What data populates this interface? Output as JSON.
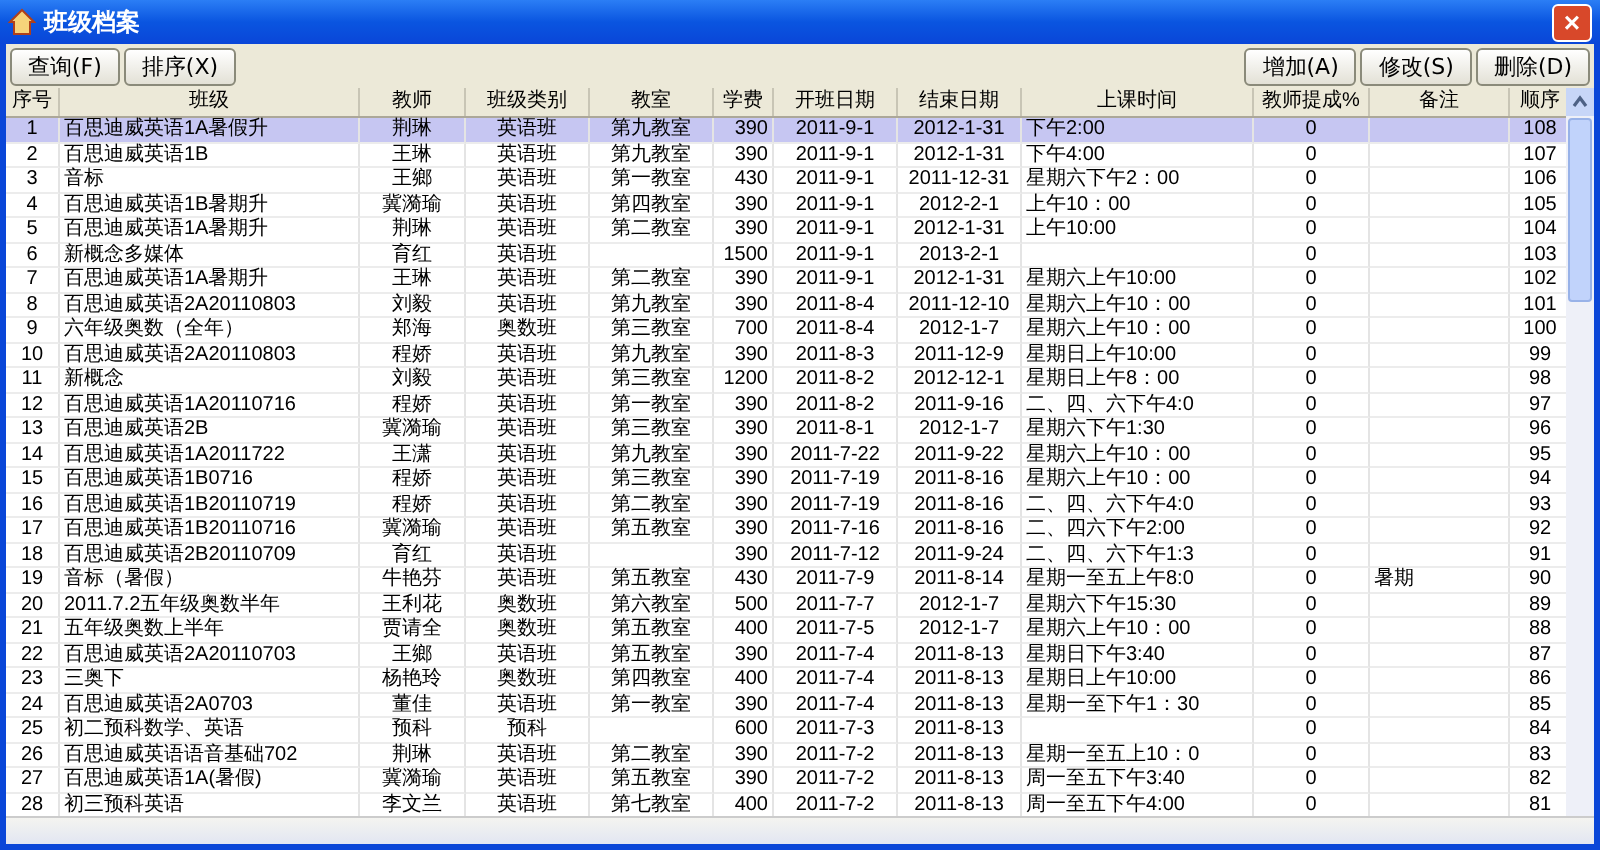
{
  "window": {
    "title": "班级档案",
    "close": "×"
  },
  "toolbar": {
    "left": [
      "查询(F)",
      "排序(X)"
    ],
    "right": [
      "增加(A)",
      "修改(S)",
      "删除(D)"
    ]
  },
  "table": {
    "columns": [
      "序号",
      "班级",
      "教师",
      "班级类别",
      "教室",
      "学费",
      "开班日期",
      "结束日期",
      "上课时间",
      "教师提成%",
      "备注",
      "顺序"
    ],
    "rows": [
      {
        "selected": true,
        "no": "1",
        "class": "百思迪威英语1A暑假升",
        "teacher": "荆琳",
        "category": "英语班",
        "room": "第九教室",
        "fee": "390",
        "start": "2011-9-1",
        "end": "2012-1-31",
        "time": "下午2:00",
        "commission": "0",
        "order": "108"
      },
      {
        "selected": false,
        "no": "2",
        "class": "百思迪威英语1B",
        "teacher": "王琳",
        "category": "英语班",
        "room": "第九教室",
        "fee": "390",
        "start": "2011-9-1",
        "end": "2012-1-31",
        "time": "下午4:00",
        "commission": "0",
        "order": "107"
      },
      {
        "selected": false,
        "no": "3",
        "class": "音标",
        "teacher": "王鄉",
        "category": "英语班",
        "room": "第一教室",
        "fee": "430",
        "start": "2011-9-1",
        "end": "2011-12-31",
        "time": "星期六下午2：00",
        "commission": "0",
        "order": "106"
      },
      {
        "selected": false,
        "no": "4",
        "class": "百思迪威英语1B暑期升",
        "teacher": "冀漪瑜",
        "category": "英语班",
        "room": "第四教室",
        "fee": "390",
        "start": "2011-9-1",
        "end": "2012-2-1",
        "time": "上午10：00",
        "commission": "0",
        "order": "105"
      },
      {
        "selected": false,
        "no": "5",
        "class": "百思迪威英语1A暑期升",
        "teacher": "荆琳",
        "category": "英语班",
        "room": "第二教室",
        "fee": "390",
        "start": "2011-9-1",
        "end": "2012-1-31",
        "time": "上午10:00",
        "commission": "0",
        "order": "104"
      },
      {
        "selected": false,
        "no": "6",
        "class": "新概念多媒体",
        "teacher": "育红",
        "category": "英语班",
        "fee": "1500",
        "start": "2011-9-1",
        "end": "2013-2-1",
        "commission": "0",
        "order": "103"
      },
      {
        "selected": false,
        "no": "7",
        "class": "百思迪威英语1A暑期升",
        "teacher": "王琳",
        "category": "英语班",
        "room": "第二教室",
        "fee": "390",
        "start": "2011-9-1",
        "end": "2012-1-31",
        "time": "星期六上午10:00",
        "commission": "0",
        "order": "102"
      },
      {
        "selected": false,
        "no": "8",
        "class": "百思迪威英语2A20110803",
        "teacher": "刘毅",
        "category": "英语班",
        "room": "第九教室",
        "fee": "390",
        "start": "2011-8-4",
        "end": "2011-12-10",
        "time": "星期六上午10：00",
        "commission": "0",
        "order": "101"
      },
      {
        "selected": false,
        "no": "9",
        "class": "六年级奥数（全年）",
        "teacher": "郑海",
        "category": "奥数班",
        "room": "第三教室",
        "fee": "700",
        "start": "2011-8-4",
        "end": "2012-1-7",
        "time": "星期六上午10：00",
        "commission": "0",
        "order": "100"
      },
      {
        "selected": false,
        "no": "10",
        "class": "百思迪威英语2A20110803",
        "teacher": "程娇",
        "category": "英语班",
        "room": "第九教室",
        "fee": "390",
        "start": "2011-8-3",
        "end": "2011-12-9",
        "time": "星期日上午10:00",
        "commission": "0",
        "order": "99"
      },
      {
        "selected": false,
        "no": "11",
        "class": "新概念",
        "teacher": "刘毅",
        "category": "英语班",
        "room": "第三教室",
        "fee": "1200",
        "start": "2011-8-2",
        "end": "2012-12-1",
        "time": "星期日上午8：00",
        "commission": "0",
        "order": "98"
      },
      {
        "selected": false,
        "no": "12",
        "class": "百思迪威英语1A20110716",
        "teacher": "程娇",
        "category": "英语班",
        "room": "第一教室",
        "fee": "390",
        "start": "2011-8-2",
        "end": "2011-9-16",
        "time": "二、四、六下午4:0",
        "commission": "0",
        "order": "97"
      },
      {
        "selected": false,
        "no": "13",
        "class": "百思迪威英语2B",
        "teacher": "冀漪瑜",
        "category": "英语班",
        "room": "第三教室",
        "fee": "390",
        "start": "2011-8-1",
        "end": "2012-1-7",
        "time": "星期六下午1:30",
        "commission": "0",
        "order": "96"
      },
      {
        "selected": false,
        "no": "14",
        "class": "百思迪威英语1A2011722",
        "teacher": "王潇",
        "category": "英语班",
        "room": "第九教室",
        "fee": "390",
        "start": "2011-7-22",
        "end": "2011-9-22",
        "time": "星期六上午10：00",
        "commission": "0",
        "order": "95"
      },
      {
        "selected": false,
        "no": "15",
        "class": "百思迪威英语1B0716",
        "teacher": "程娇",
        "category": "英语班",
        "room": "第三教室",
        "fee": "390",
        "start": "2011-7-19",
        "end": "2011-8-16",
        "time": "星期六上午10：00",
        "commission": "0",
        "order": "94"
      },
      {
        "selected": false,
        "no": "16",
        "class": "百思迪威英语1B20110719",
        "teacher": "程娇",
        "category": "英语班",
        "room": "第二教室",
        "fee": "390",
        "start": "2011-7-19",
        "end": "2011-8-16",
        "time": "二、四、六下午4:0",
        "commission": "0",
        "order": "93"
      },
      {
        "selected": false,
        "no": "17",
        "class": "百思迪威英语1B20110716",
        "teacher": "冀漪瑜",
        "category": "英语班",
        "room": "第五教室",
        "fee": "390",
        "start": "2011-7-16",
        "end": "2011-8-16",
        "time": "二、四六下午2:00",
        "commission": "0",
        "order": "92"
      },
      {
        "selected": false,
        "no": "18",
        "class": "百思迪威英语2B20110709",
        "teacher": "育红",
        "category": "英语班",
        "fee": "390",
        "start": "2011-7-12",
        "end": "2011-9-24",
        "time": "二、四、六下午1:3",
        "commission": "0",
        "order": "91"
      },
      {
        "selected": false,
        "no": "19",
        "class": "音标（暑假）",
        "teacher": "牛艳芬",
        "category": "英语班",
        "room": "第五教室",
        "fee": "430",
        "start": "2011-7-9",
        "end": "2011-8-14",
        "time": "星期一至五上午8:0",
        "commission": "0",
        "note": "暑期",
        "order": "90"
      },
      {
        "selected": false,
        "no": "20",
        "class": "2011.7.2五年级奥数半年",
        "teacher": "王利花",
        "category": "奥数班",
        "room": "第六教室",
        "fee": "500",
        "start": "2011-7-7",
        "end": "2012-1-7",
        "time": "星期六下午15:30",
        "commission": "0",
        "order": "89"
      },
      {
        "selected": false,
        "no": "21",
        "class": "五年级奥数上半年",
        "teacher": "贾请全",
        "category": "奥数班",
        "room": "第五教室",
        "fee": "400",
        "start": "2011-7-5",
        "end": "2012-1-7",
        "time": "星期六上午10：00",
        "commission": "0",
        "order": "88"
      },
      {
        "selected": false,
        "no": "22",
        "class": "百思迪威英语2A20110703",
        "teacher": "王鄉",
        "category": "英语班",
        "room": "第五教室",
        "fee": "390",
        "start": "2011-7-4",
        "end": "2011-8-13",
        "time": "星期日下午3:40",
        "commission": "0",
        "order": "87"
      },
      {
        "selected": false,
        "no": "23",
        "class": "三奥下",
        "teacher": "杨艳玲",
        "category": "奥数班",
        "room": "第四教室",
        "fee": "400",
        "start": "2011-7-4",
        "end": "2011-8-13",
        "time": "星期日上午10:00",
        "commission": "0",
        "order": "86"
      },
      {
        "selected": false,
        "no": "24",
        "class": "百思迪威英语2A0703",
        "teacher": "董佳",
        "category": "英语班",
        "room": "第一教室",
        "fee": "390",
        "start": "2011-7-4",
        "end": "2011-8-13",
        "time": "星期一至下午1：30",
        "commission": "0",
        "order": "85"
      },
      {
        "selected": false,
        "no": "25",
        "class": "初二预科数学、英语",
        "teacher": "预科",
        "category": "预科",
        "fee": "600",
        "start": "2011-7-3",
        "end": "2011-8-13",
        "commission": "0",
        "order": "84"
      },
      {
        "selected": false,
        "no": "26",
        "class": "百思迪威英语语音基础702",
        "teacher": "荆琳",
        "category": "英语班",
        "room": "第二教室",
        "fee": "390",
        "start": "2011-7-2",
        "end": "2011-8-13",
        "time": "星期一至五上10：0",
        "commission": "0",
        "order": "83"
      },
      {
        "selected": false,
        "no": "27",
        "class": "百思迪威英语1A(暑假)",
        "teacher": "冀漪瑜",
        "category": "英语班",
        "room": "第五教室",
        "fee": "390",
        "start": "2011-7-2",
        "end": "2011-8-13",
        "time": "周一至五下午3:40",
        "commission": "0",
        "order": "82"
      },
      {
        "selected": false,
        "no": "28",
        "class": "初三预科英语",
        "teacher": "李文兰",
        "category": "英语班",
        "room": "第七教室",
        "fee": "400",
        "start": "2011-7-2",
        "end": "2011-8-13",
        "time": "周一至五下午4:00",
        "commission": "0",
        "order": "81"
      }
    ]
  }
}
